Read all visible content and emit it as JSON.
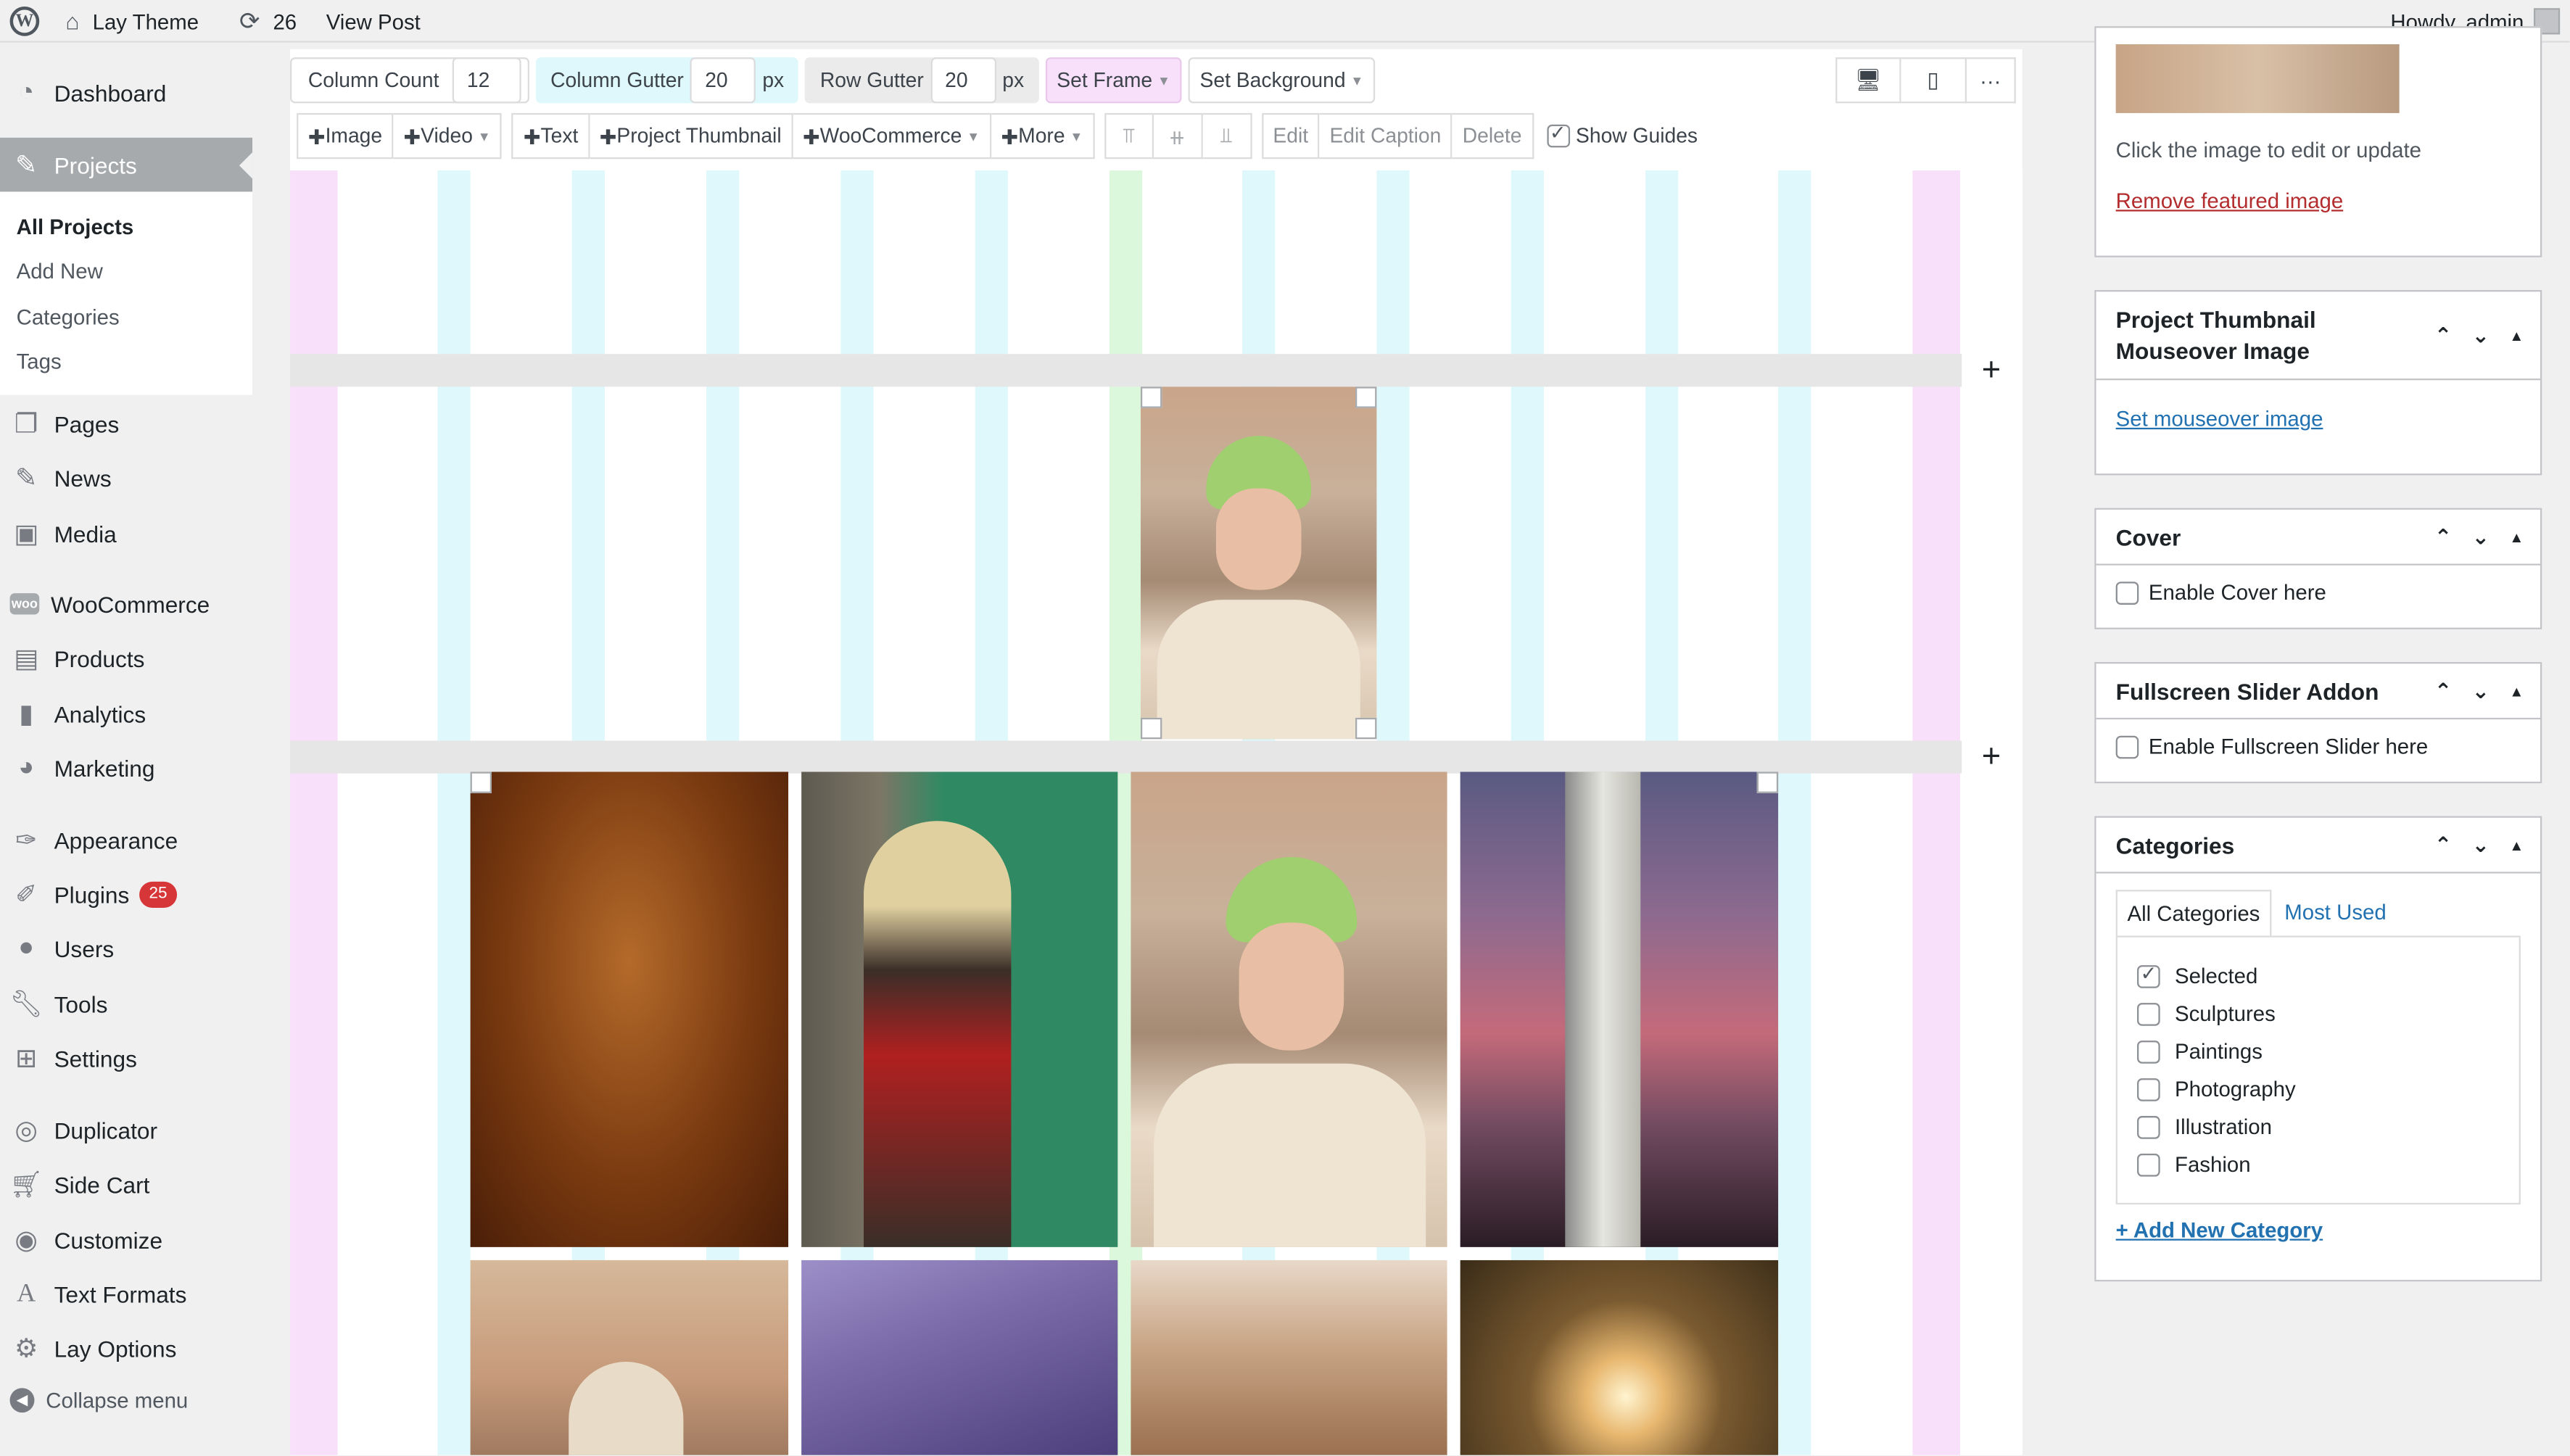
{
  "adminbar": {
    "site_name": "Lay Theme",
    "updates_count": "26",
    "view_post": "View Post",
    "howdy": "Howdy, admin"
  },
  "sidebar": {
    "dashboard": "Dashboard",
    "projects": "Projects",
    "submenu": [
      "All Projects",
      "Add New",
      "Categories",
      "Tags"
    ],
    "items": [
      "Pages",
      "News",
      "Media",
      "WooCommerce",
      "Products",
      "Analytics",
      "Marketing",
      "Appearance",
      "Plugins",
      "Users",
      "Tools",
      "Settings",
      "Duplicator",
      "Side Cart",
      "Customize",
      "Text Formats",
      "Lay Options"
    ],
    "plugins_badge": "25",
    "collapse": "Collapse menu"
  },
  "toolbar": {
    "column_count_label": "Column Count",
    "column_count_value": "12",
    "column_gutter_label": "Column Gutter",
    "column_gutter_value": "20",
    "px": "px",
    "row_gutter_label": "Row Gutter",
    "row_gutter_value": "20",
    "set_frame": "Set Frame",
    "set_background": "Set Background",
    "image": "Image",
    "video": "Video",
    "text": "Text",
    "project_thumbnail": "Project Thumbnail",
    "woocommerce": "WooCommerce",
    "more": "More",
    "edit": "Edit",
    "edit_caption": "Edit Caption",
    "delete": "Delete",
    "show_guides": "Show Guides",
    "more_dots": "···"
  },
  "right_panel": {
    "featured_hint": "Click the image to edit or update",
    "remove_featured": "Remove featured image",
    "mouseover_title": "Project Thumbnail Mouseover Image",
    "set_mouseover": "Set mouseover image",
    "cover_title": "Cover",
    "enable_cover": "Enable Cover here",
    "slider_title": "Fullscreen Slider Addon",
    "enable_slider": "Enable Fullscreen Slider here",
    "categories_title": "Categories",
    "tab_all": "All Categories",
    "tab_most_used": "Most Used",
    "categories": [
      "Selected",
      "Sculptures",
      "Paintings",
      "Photography",
      "Illustration",
      "Fashion"
    ],
    "add_new_category": "+ Add New Category"
  },
  "colors": {
    "guide_cyan": "#dff8fb",
    "guide_pink": "#f8e0fa",
    "guide_green": "#dcf8dc",
    "accent_blue": "#2271b1",
    "badge_red": "#d63638"
  }
}
